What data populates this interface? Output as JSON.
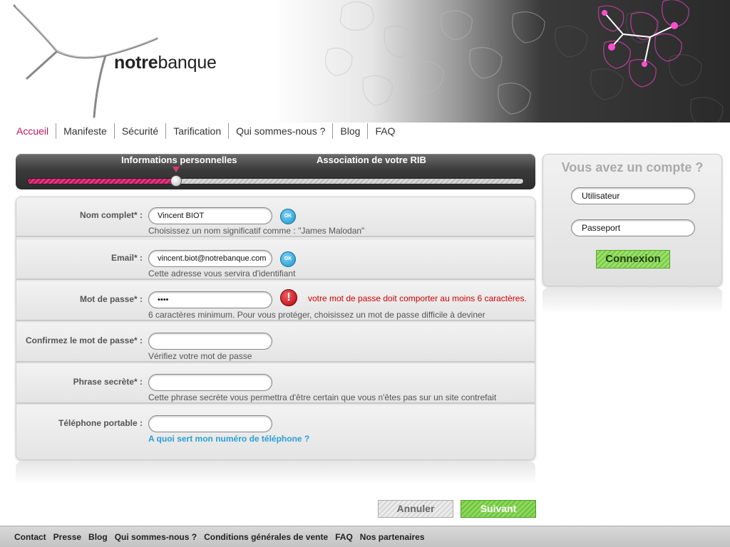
{
  "brand": {
    "logo_bold": "notre",
    "logo_regular": "banque"
  },
  "nav": {
    "items": [
      {
        "label": "Accueil",
        "active": true
      },
      {
        "label": "Manifeste"
      },
      {
        "label": "Sécurité"
      },
      {
        "label": "Tarification"
      },
      {
        "label": "Qui sommes-nous ?"
      },
      {
        "label": "Blog"
      },
      {
        "label": "FAQ"
      }
    ]
  },
  "progress": {
    "steps": [
      "Informations personnelles",
      "Association de votre RIB"
    ],
    "current_step": 1,
    "fraction": 0.3
  },
  "form": {
    "fields": [
      {
        "label": "Nom complet* :",
        "value": "Vincent BIOT",
        "help": "Choisissez un nom significatif comme : \"James Malodan\"",
        "status": "OK"
      },
      {
        "label": "Email* :",
        "value": "vincent.biot@notrebanque.com",
        "help": "Cette adresse vous servira d'identifiant",
        "status": "OK"
      },
      {
        "label": "Mot de passe* :",
        "value": "••••",
        "help": "6 caractères minimum. Pour vous protéger, choisissez un mot de passe difficile à deviner",
        "status": "!",
        "error": "votre mot de passe doit comporter au moins 6 caractères."
      },
      {
        "label": "Confirmez le mot de passe* :",
        "value": "",
        "help": "Vérifiez votre mot de passe"
      },
      {
        "label": "Phrase secrète* :",
        "value": "",
        "help": "Cette phrase secrète vous permettra d'être certain que vous n'êtes pas sur un site contrefait"
      },
      {
        "label": "Téléphone portable :",
        "value": "",
        "help": "A quoi sert mon numéro de téléphone ?"
      }
    ]
  },
  "buttons": {
    "cancel": "Annuler",
    "next": "Suivant"
  },
  "login": {
    "title": "Vous avez un compte ?",
    "user_value": "Utilisateur",
    "pass_value": "Passeport",
    "submit": "Connexion"
  },
  "footer": {
    "items": [
      "Contact",
      "Presse",
      "Blog",
      "Qui sommes-nous ?",
      "Conditions générales de vente",
      "FAQ",
      "Nos partenaires"
    ]
  },
  "colors": {
    "accent": "#c2185b",
    "error": "#d10000",
    "ok": "#1a94c9",
    "success": "#6cc13d",
    "link": "#2a9fd6"
  }
}
